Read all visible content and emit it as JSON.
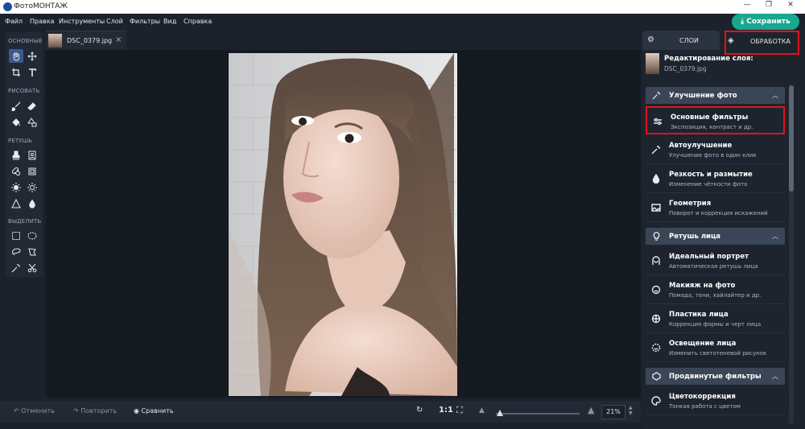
{
  "app": {
    "title": "ФотоМОНТАЖ"
  },
  "menu": [
    "Файл",
    "Правка",
    "Инструменты",
    "Слой",
    "Фильтры",
    "Вид",
    "Справка"
  ],
  "save_label": "Сохранить",
  "toolbox": {
    "sections": [
      "ОСНОВНЫЕ",
      "РИСОВАТЬ",
      "РЕТУШЬ",
      "ВЫДЕЛИТЬ"
    ]
  },
  "document_tab": {
    "name": "DSC_0379.jpg",
    "close": "×"
  },
  "bottom": {
    "undo": "Отменить",
    "redo": "Повторить",
    "compare": "Сравнить",
    "ratio": "1:1",
    "zoom": "21%"
  },
  "right_panel": {
    "tab_layers": "СЛОИ",
    "tab_processing": "ОБРАБОТКА",
    "edit_title": "Редактирование слоя:",
    "edit_file": "DSC_0379.jpg",
    "categories": [
      {
        "label": "Улучшение фото"
      },
      {
        "label": "Ретушь лица"
      },
      {
        "label": "Продвинутые фильтры"
      }
    ],
    "items": [
      {
        "title": "Основные фильтры",
        "sub": "Экспозиция, контраст и др."
      },
      {
        "title": "Автоулучшение",
        "sub": "Улучшение фото в один клик"
      },
      {
        "title": "Резкость и размытие",
        "sub": "Изменение чёткости фото"
      },
      {
        "title": "Геометрия",
        "sub": "Поворот и коррекция искажений"
      },
      {
        "title": "Идеальный портрет",
        "sub": "Автоматическая ретушь лица"
      },
      {
        "title": "Макияж на фото",
        "sub": "Помада, тени, хайлайтер и др."
      },
      {
        "title": "Пластика лица",
        "sub": "Коррекция формы и черт лица"
      },
      {
        "title": "Освещение лица",
        "sub": "Изменить светотеневой рисунок"
      },
      {
        "title": "Цветокоррекция",
        "sub": "Тонкая работа с цветом"
      }
    ]
  },
  "colors": {
    "accent_green": "#1aa68f",
    "highlight_red": "#e0121d",
    "panel": "#1e242e",
    "category_bg": "#3a4556"
  }
}
